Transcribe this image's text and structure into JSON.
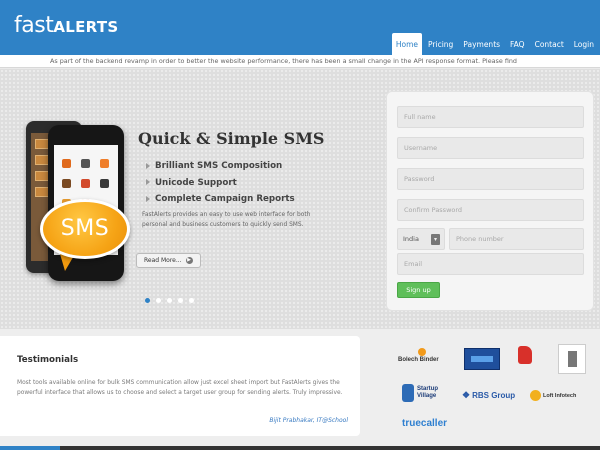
{
  "brand": {
    "logo_fast": "fast",
    "logo_alerts": "ALERTS"
  },
  "nav": {
    "items": [
      {
        "label": "Home",
        "active": true
      },
      {
        "label": "Pricing",
        "active": false
      },
      {
        "label": "Payments",
        "active": false
      },
      {
        "label": "FAQ",
        "active": false
      },
      {
        "label": "Contact",
        "active": false
      },
      {
        "label": "Login",
        "active": false
      }
    ]
  },
  "ticker": {
    "text": "As part of the backend revamp in order to better the website performance, there has been a small change in the API response format. Please find"
  },
  "hero": {
    "title": "Quick & Simple  SMS",
    "features": [
      "Brilliant SMS Composition",
      "Unicode Support",
      "Complete Campaign Reports"
    ],
    "description": "FastAlerts provides an easy to use web interface for both personal and business customers to quickly send SMS.",
    "read_more": "Read More...",
    "bubble_text": "SMS",
    "slides": 5,
    "active_slide": 1
  },
  "signup": {
    "full_name_placeholder": "Full name",
    "username_placeholder": "Username",
    "password_placeholder": "Password",
    "confirm_password_placeholder": "Confirm Password",
    "country_code": "India",
    "phone_placeholder": "Phone number",
    "email_placeholder": "Email",
    "submit_label": "Sign up"
  },
  "testimonials": {
    "title": "Testimonials",
    "text": "Most tools available online for bulk SMS communication allow just excel sheet import but FastAlerts gives the powerful interface that allows us to choose and select a target user group for sending alerts. Truly impressive.",
    "author": "Bijit Prabhakar, IT@School"
  },
  "clients": {
    "c1": "Bolech Binder",
    "c2": "Startup Village",
    "c3": "RBS Group",
    "c4": "Loft Infotech",
    "c5": "truecaller"
  },
  "colors": {
    "brand_blue": "#2f82c6",
    "signup_green": "#5fbf5a",
    "bubble_orange": "#f6a416"
  }
}
